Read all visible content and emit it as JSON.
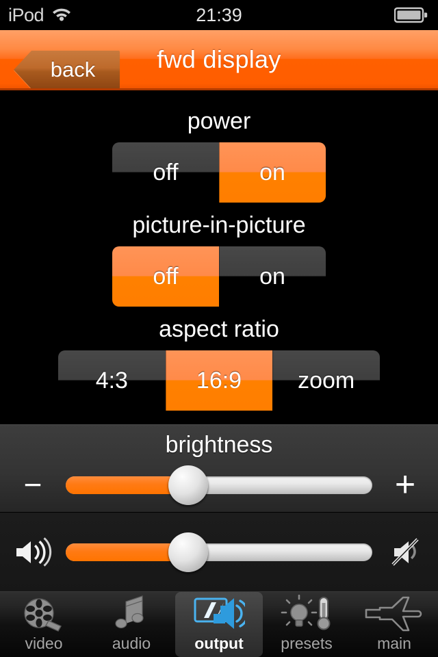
{
  "status_bar": {
    "carrier": "iPod",
    "wifi_icon": "wifi-icon",
    "time": "21:39",
    "battery_icon": "battery-icon",
    "battery_level_pct": 82
  },
  "nav_bar": {
    "back_label": "back",
    "title": "fwd display",
    "accent_color": "#ff6000"
  },
  "controls": [
    {
      "label": "power",
      "name": "power",
      "options": [
        "off",
        "on"
      ],
      "selected_index": 1
    },
    {
      "label": "picture-in-picture",
      "name": "picture-in-picture",
      "options": [
        "off",
        "on"
      ],
      "selected_index": 0
    },
    {
      "label": "aspect ratio",
      "name": "aspect-ratio",
      "options": [
        "4:3",
        "16:9",
        "zoom"
      ],
      "selected_index": 1
    }
  ],
  "brightness": {
    "label": "brightness",
    "minus_label": "−",
    "plus_label": "+",
    "value_pct": 40
  },
  "volume": {
    "speaker_icon": "speaker-icon",
    "mute_icon": "mute-icon",
    "value_pct": 40
  },
  "tab_bar": {
    "selected": "output",
    "items": [
      {
        "label": "video",
        "icon": "film-reel-icon",
        "selected": false
      },
      {
        "label": "audio",
        "icon": "music-note-icon",
        "selected": false
      },
      {
        "label": "output",
        "icon": "display-speaker-icon",
        "selected": true
      },
      {
        "label": "presets",
        "icon": "bulb-thermometer-icon",
        "selected": false
      },
      {
        "label": "main",
        "icon": "airplane-icon",
        "selected": false
      }
    ]
  },
  "colors": {
    "orange_top": "#ff9457",
    "orange_bottom": "#ff8000",
    "segment_off_top": "#484848",
    "segment_off_bottom": "#000000",
    "tab_selected_icon": "#3aa7e8"
  }
}
